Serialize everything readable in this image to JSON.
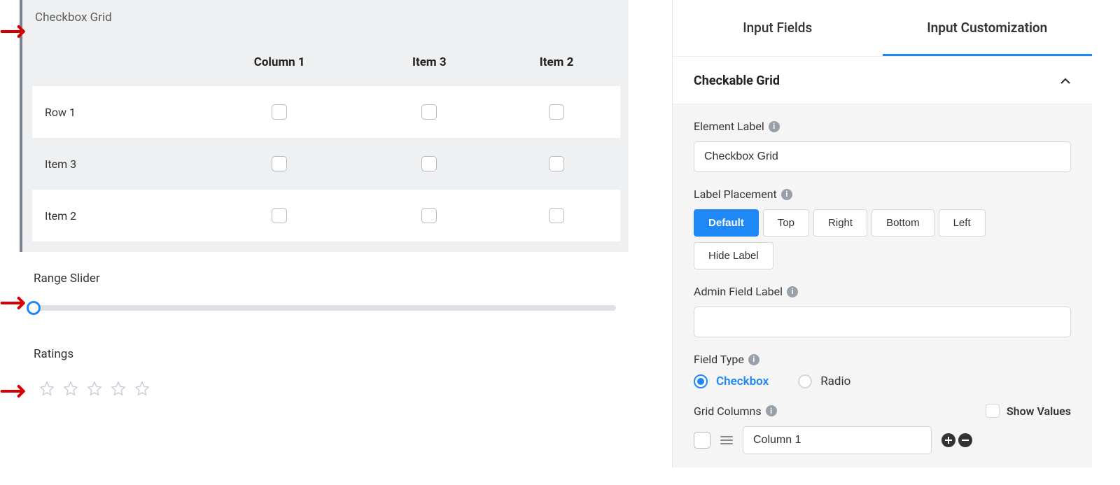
{
  "preview": {
    "checkbox_grid": {
      "title": "Checkbox Grid",
      "columns": [
        "Column 1",
        "Item 3",
        "Item 2"
      ],
      "rows": [
        "Row 1",
        "Item 3",
        "Item 2"
      ]
    },
    "range_slider": {
      "title": "Range Slider"
    },
    "ratings": {
      "title": "Ratings",
      "count": 5
    }
  },
  "tabs": {
    "input_fields": "Input Fields",
    "input_customization": "Input Customization"
  },
  "section": {
    "title": "Checkable Grid"
  },
  "settings": {
    "element_label": {
      "label": "Element Label",
      "value": "Checkbox Grid"
    },
    "label_placement": {
      "label": "Label Placement",
      "options": [
        "Default",
        "Top",
        "Right",
        "Bottom",
        "Left"
      ],
      "extra": "Hide Label",
      "active": "Default"
    },
    "admin_field_label": {
      "label": "Admin Field Label",
      "value": ""
    },
    "field_type": {
      "label": "Field Type",
      "options": {
        "checkbox": "Checkbox",
        "radio": "Radio"
      },
      "active": "checkbox"
    },
    "grid_columns": {
      "label": "Grid Columns",
      "show_values_label": "Show Values",
      "items": [
        {
          "value": "Column 1"
        }
      ]
    }
  }
}
